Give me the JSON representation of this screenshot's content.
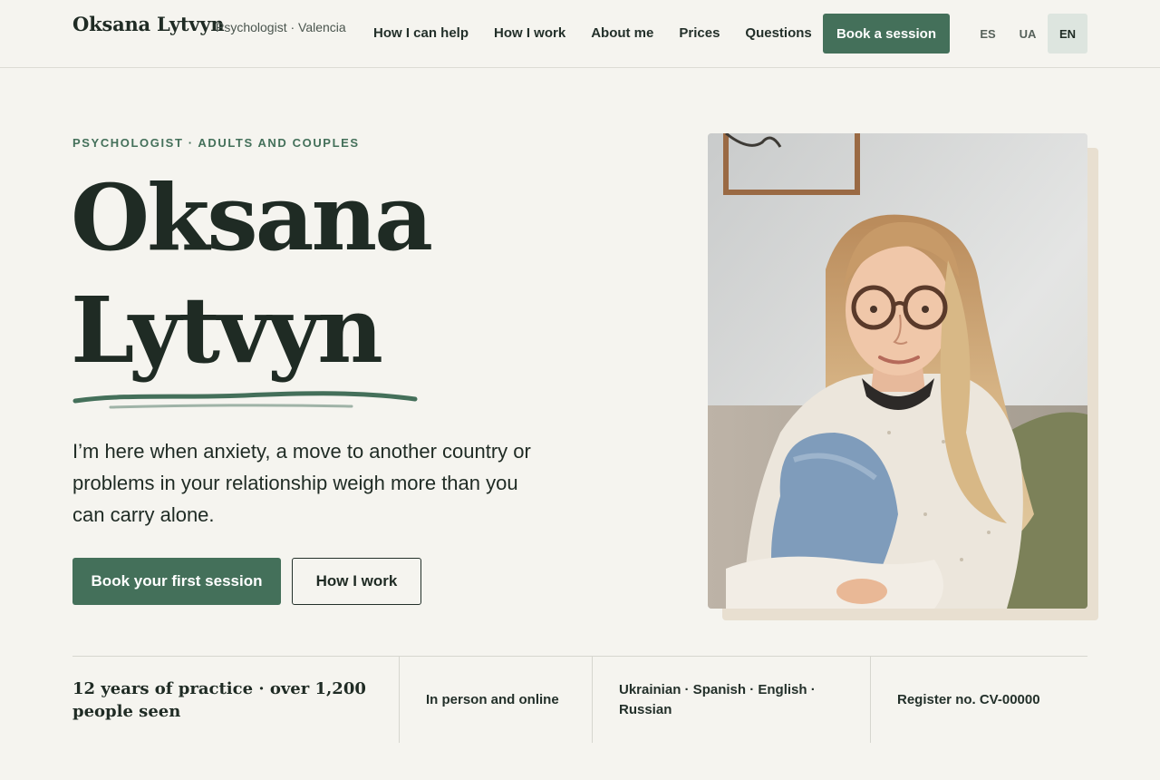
{
  "header": {
    "brand_name": "Oksana Lytvyn",
    "brand_subtitle": "Psychologist · Valencia",
    "nav": [
      {
        "label": "How I can help"
      },
      {
        "label": "How I work"
      },
      {
        "label": "About me"
      },
      {
        "label": "Prices"
      },
      {
        "label": "Questions"
      }
    ],
    "book_label": "Book a session",
    "languages": [
      "ES",
      "UA",
      "EN"
    ],
    "active_language": "EN"
  },
  "hero": {
    "eyebrow": "PSYCHOLOGIST · ADULTS AND COUPLES",
    "title_line1": "Oksana",
    "title_line2": "Lytvyn",
    "lead": "I’m here when anxiety, a move to another country or problems in your relationship weigh more than you can carry alone.",
    "cta_primary": "Book your first session",
    "cta_secondary": "How I work"
  },
  "stats": [
    {
      "text": "12 years of practice · over 1,200 people seen"
    },
    {
      "text": "In person and online"
    },
    {
      "text": "Ukrainian · Spanish · English · Russian"
    },
    {
      "text": "Register no. CV-00000"
    }
  ],
  "colors": {
    "background": "#f5f4ef",
    "accent": "#44705a",
    "text": "#1f2b24",
    "photo_shadow": "#e8dfd0",
    "active_lang_bg": "#dde5df"
  }
}
